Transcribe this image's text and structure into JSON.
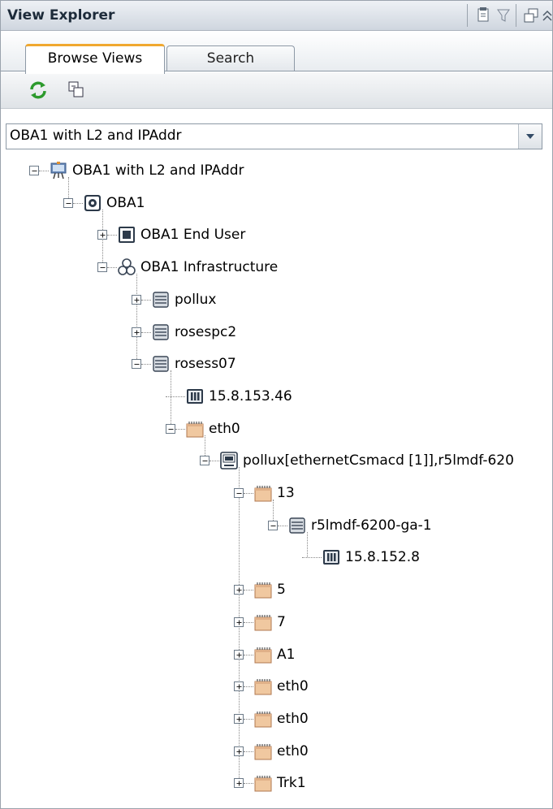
{
  "window": {
    "title": "View Explorer",
    "toolbar_icons": [
      "document-icon",
      "filter-icon",
      "restore-icon",
      "collapse-icon"
    ]
  },
  "tabs": [
    {
      "label": "Browse Views",
      "active": true
    },
    {
      "label": "Search",
      "active": false
    }
  ],
  "toolbar": {
    "icons": [
      "refresh-icon",
      "expand-view-icon"
    ]
  },
  "view_selector": {
    "value": "OBA1 with L2 and IPAddr"
  },
  "tree": [
    {
      "label": "OBA1 with L2 and IPAddr",
      "icon": "view-icon",
      "depth": 0,
      "state": "expanded"
    },
    {
      "label": "OBA1",
      "icon": "application-icon",
      "depth": 1,
      "state": "expanded"
    },
    {
      "label": "OBA1 End User",
      "icon": "end-user-icon",
      "depth": 2,
      "state": "collapsed"
    },
    {
      "label": "OBA1 Infrastructure",
      "icon": "infrastructure-icon",
      "depth": 2,
      "state": "expanded"
    },
    {
      "label": "pollux",
      "icon": "server-icon",
      "depth": 3,
      "state": "collapsed"
    },
    {
      "label": "rosespc2",
      "icon": "server-icon",
      "depth": 3,
      "state": "collapsed"
    },
    {
      "label": "rosess07",
      "icon": "server-icon",
      "depth": 3,
      "state": "expanded"
    },
    {
      "label": "15.8.153.46",
      "icon": "ip-address-icon",
      "depth": 4,
      "state": "leaf"
    },
    {
      "label": "eth0",
      "icon": "interface-icon",
      "depth": 4,
      "state": "expanded"
    },
    {
      "label": "pollux[ethernetCsmacd [1]],r5lmdf-620",
      "icon": "connection-icon",
      "depth": 5,
      "state": "expanded"
    },
    {
      "label": "13",
      "icon": "interface-icon",
      "depth": 6,
      "state": "expanded"
    },
    {
      "label": "r5lmdf-6200-ga-1",
      "icon": "server-icon",
      "depth": 7,
      "state": "expanded"
    },
    {
      "label": "15.8.152.8",
      "icon": "ip-address-icon",
      "depth": 8,
      "state": "leaf"
    },
    {
      "label": "5",
      "icon": "interface-icon",
      "depth": 6,
      "state": "collapsed"
    },
    {
      "label": "7",
      "icon": "interface-icon",
      "depth": 6,
      "state": "collapsed"
    },
    {
      "label": "A1",
      "icon": "interface-icon",
      "depth": 6,
      "state": "collapsed"
    },
    {
      "label": "eth0",
      "icon": "interface-icon",
      "depth": 6,
      "state": "collapsed"
    },
    {
      "label": "eth0",
      "icon": "interface-icon",
      "depth": 6,
      "state": "collapsed"
    },
    {
      "label": "eth0",
      "icon": "interface-icon",
      "depth": 6,
      "state": "collapsed"
    },
    {
      "label": "Trk1",
      "icon": "interface-icon",
      "depth": 6,
      "state": "collapsed"
    }
  ]
}
